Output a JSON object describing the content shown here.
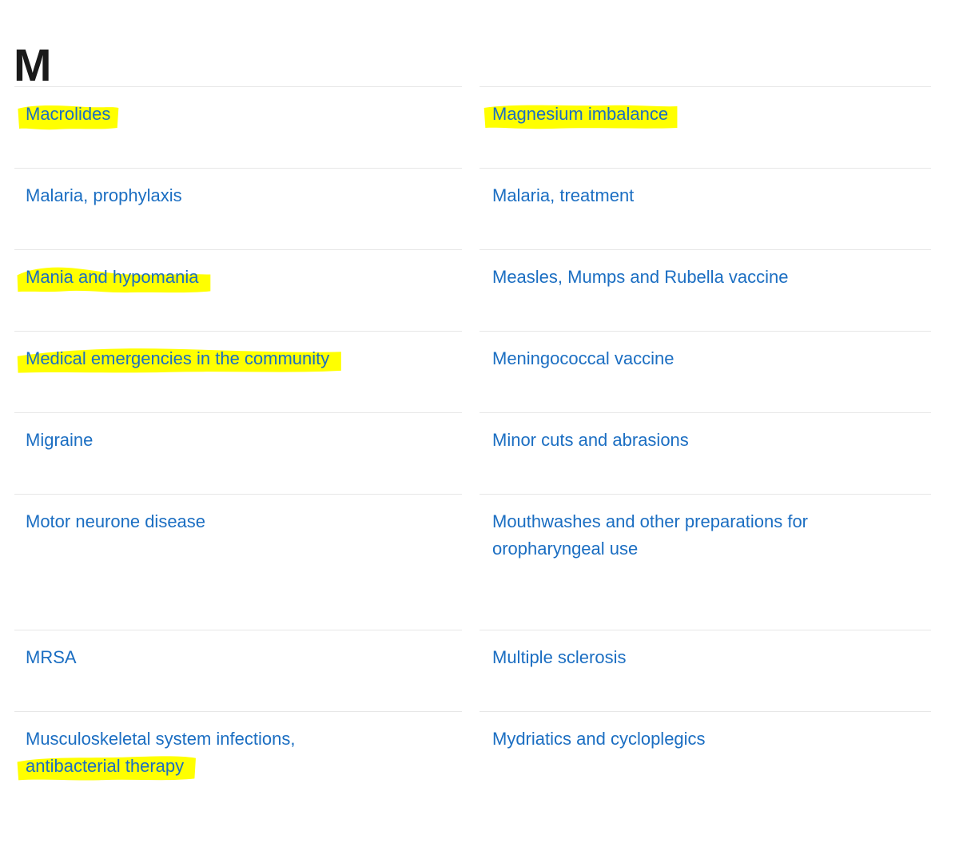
{
  "page": {
    "heading": "M",
    "type": "a-to-z-index",
    "letter": "M"
  },
  "colors": {
    "link": "#1b6ec2",
    "heading": "#1a1a1a",
    "divider": "#e7e7e7",
    "highlight": "#ffff00",
    "background": "#ffffff"
  },
  "index": {
    "rows": [
      {
        "left": {
          "label": "Macrolides",
          "highlighted": true,
          "highlight_width": 158
        },
        "right": {
          "label": "Magnesium imbalance",
          "highlighted": true,
          "highlight_width": 285
        }
      },
      {
        "left": {
          "label": "Malaria, prophylaxis",
          "highlighted": false
        },
        "right": {
          "label": "Malaria, treatment",
          "highlighted": false
        }
      },
      {
        "left": {
          "label": "Mania and hypomania",
          "highlighted": true,
          "highlight_width": 300
        },
        "right": {
          "label": "Measles, Mumps and Rubella vaccine",
          "highlighted": false
        }
      },
      {
        "left": {
          "label": "Medical emergencies in the community",
          "highlighted": true,
          "highlight_width": 465
        },
        "right": {
          "label": "Meningococcal vaccine",
          "highlighted": false
        }
      },
      {
        "left": {
          "label": "Migraine",
          "highlighted": false
        },
        "right": {
          "label": "Minor cuts and abrasions",
          "highlighted": false
        }
      },
      {
        "left": {
          "label": "Motor neurone disease",
          "highlighted": false
        },
        "right": {
          "label": "Mouthwashes and other preparations for oropharyngeal use",
          "highlighted": false
        },
        "tall": true
      },
      {
        "left": {
          "label": "MRSA",
          "highlighted": false
        },
        "right": {
          "label": "Multiple sclerosis",
          "highlighted": false
        }
      },
      {
        "left": {
          "label": "Musculoskeletal system infections, antibacterial therapy",
          "line1": "Musculoskeletal system infections,",
          "line2": "antibacterial therapy",
          "highlighted": false,
          "line2_highlighted": true,
          "highlight_width": 275
        },
        "right": {
          "label": "Mydriatics and cycloplegics",
          "highlighted": false
        },
        "tall": true
      }
    ]
  }
}
